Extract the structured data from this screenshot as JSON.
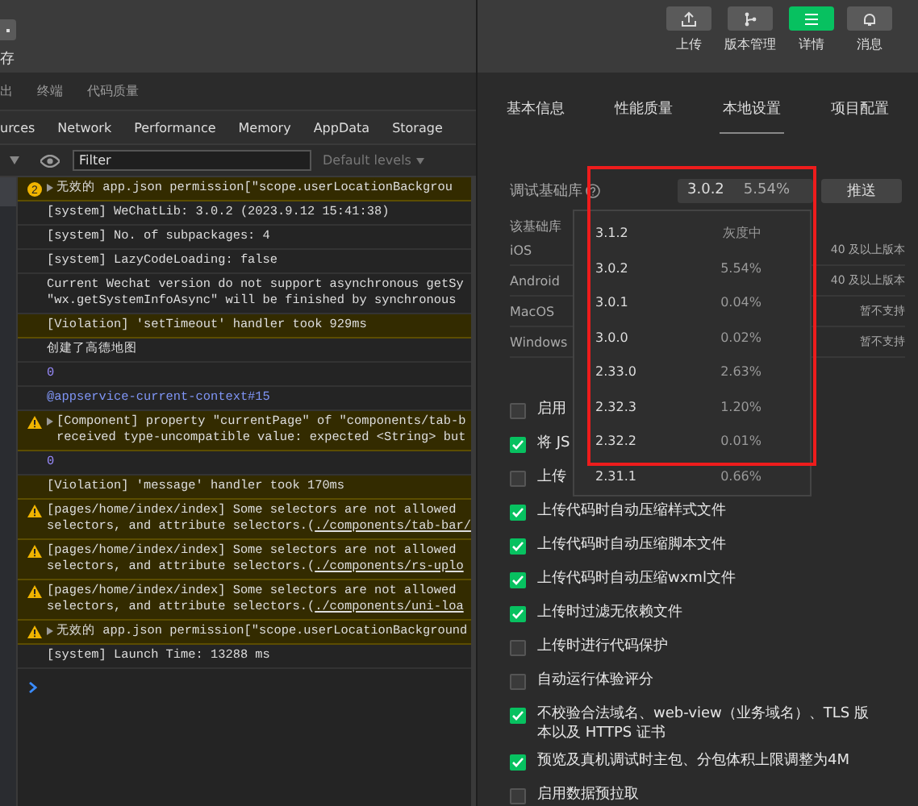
{
  "left_toolbar": {
    "button_label": "存"
  },
  "panel_tabs": [
    {
      "label": "出",
      "selected": false
    },
    {
      "label": "终端",
      "selected": false
    },
    {
      "label": "代码质量",
      "selected": false
    }
  ],
  "devtools_tabs": [
    {
      "label": "urces",
      "selected": false
    },
    {
      "label": "Network",
      "selected": false
    },
    {
      "label": "Performance",
      "selected": false
    },
    {
      "label": "Memory",
      "selected": false
    },
    {
      "label": "AppData",
      "selected": false
    },
    {
      "label": "Storage",
      "selected": false
    }
  ],
  "filter": {
    "placeholder": "Filter",
    "levels": "Default levels"
  },
  "console": [
    {
      "kind": "warning",
      "count": "2",
      "expandable": true,
      "lines": [
        "无效的 app.json permission[\"scope.userLocationBackgrou"
      ]
    },
    {
      "kind": "info",
      "lines": [
        "[system] WeChatLib: 3.0.2 (2023.9.12 15:41:38)"
      ]
    },
    {
      "kind": "info",
      "lines": [
        "[system] No. of subpackages: 4"
      ]
    },
    {
      "kind": "info",
      "lines": [
        "[system] LazyCodeLoading: false"
      ]
    },
    {
      "kind": "info",
      "lines": [
        "Current Wechat version do not support asynchronous getSy",
        "\"wx.getSystemInfoAsync\" will be finished by synchronous"
      ]
    },
    {
      "kind": "violation",
      "lines": [
        "[Violation] 'setTimeout' handler took 929ms"
      ]
    },
    {
      "kind": "info",
      "lines": [
        "创建了高德地图"
      ]
    },
    {
      "kind": "number",
      "lines": [
        "0"
      ]
    },
    {
      "kind": "context",
      "lines": [
        "@appservice-current-context#15"
      ]
    },
    {
      "kind": "warning",
      "expandable": true,
      "lines": [
        "[Component] property \"currentPage\" of \"components/tab-b",
        "received type-uncompatible value: expected <String> but"
      ]
    },
    {
      "kind": "number",
      "lines": [
        "0"
      ]
    },
    {
      "kind": "violation",
      "lines": [
        "[Violation] 'message' handler took 170ms"
      ]
    },
    {
      "kind": "warning",
      "lines": [
        "[pages/home/index/index] Some selectors are not allowed",
        "selectors, and attribute selectors.("
      ],
      "link": "./components/tab-bar/"
    },
    {
      "kind": "warning",
      "lines": [
        "[pages/home/index/index] Some selectors are not allowed",
        "selectors, and attribute selectors.("
      ],
      "link": "./components/rs-uplo"
    },
    {
      "kind": "warning",
      "lines": [
        "[pages/home/index/index] Some selectors are not allowed",
        "selectors, and attribute selectors.("
      ],
      "link": "./components/uni-loa"
    },
    {
      "kind": "warning",
      "expandable": true,
      "lines": [
        "无效的 app.json permission[\"scope.userLocationBackground"
      ]
    },
    {
      "kind": "info",
      "lines": [
        "[system] Launch Time: 13288 ms"
      ]
    }
  ],
  "toolbar": [
    {
      "label": "上传",
      "selected": false
    },
    {
      "label": "版本管理",
      "selected": false
    },
    {
      "label": "详情",
      "selected": true
    },
    {
      "label": "消息",
      "selected": false
    }
  ],
  "settings_tabs": [
    {
      "label": "基本信息",
      "selected": false
    },
    {
      "label": "性能质量",
      "selected": false
    },
    {
      "label": "本地设置",
      "selected": true
    },
    {
      "label": "项目配置",
      "selected": false
    }
  ],
  "library": {
    "label": "调试基础库",
    "version": "3.0.2",
    "share": "5.54%",
    "push": "推送",
    "note": "该基础库",
    "platforms": [
      {
        "name": "iOS",
        "support": "40 及以上版本"
      },
      {
        "name": "Android",
        "support": "40 及以上版本"
      },
      {
        "name": "MacOS",
        "support": "暂不支持"
      },
      {
        "name": "Windows",
        "support": "暂不支持"
      }
    ],
    "options": [
      {
        "version": "3.1.2",
        "share": "灰度中"
      },
      {
        "version": "3.0.2",
        "share": "5.54%"
      },
      {
        "version": "3.0.1",
        "share": "0.04%"
      },
      {
        "version": "3.0.0",
        "share": "0.02%"
      },
      {
        "version": "2.33.0",
        "share": "2.63%"
      },
      {
        "version": "2.32.3",
        "share": "1.20%"
      },
      {
        "version": "2.32.2",
        "share": "0.01%"
      },
      {
        "version": "2.31.1",
        "share": "0.66%"
      }
    ]
  },
  "checkboxes": [
    {
      "label": "启用",
      "checked": false
    },
    {
      "label": "将 JS",
      "checked": true
    },
    {
      "label": "上传",
      "checked": false
    },
    {
      "label": "上传代码时自动压缩样式文件",
      "checked": true
    },
    {
      "label": "上传代码时自动压缩脚本文件",
      "checked": true
    },
    {
      "label": "上传代码时自动压缩wxml文件",
      "checked": true
    },
    {
      "label": "上传时过滤无依赖文件",
      "checked": true
    },
    {
      "label": "上传时进行代码保护",
      "checked": false
    },
    {
      "label": "自动运行体验评分",
      "checked": false
    },
    {
      "label": "不校验合法域名、web-view（业务域名）、TLS 版本以及 HTTPS 证书",
      "checked": true
    },
    {
      "label": "预览及真机调试时主包、分包体积上限调整为4M",
      "checked": true
    },
    {
      "label": "启用数据预拉取",
      "checked": false
    }
  ]
}
